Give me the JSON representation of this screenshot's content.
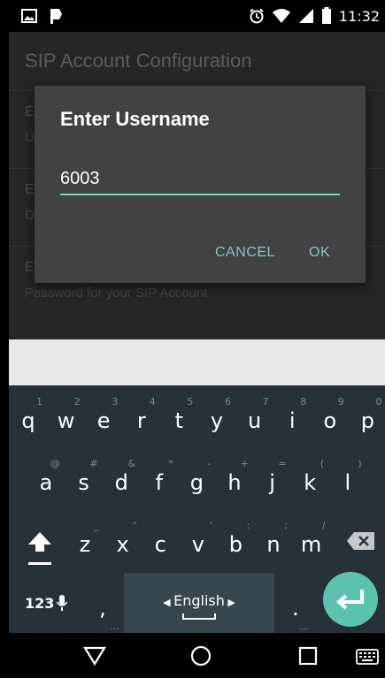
{
  "status_bar": {
    "time": "11:32"
  },
  "app": {
    "title": "SIP Account Configuration",
    "prefs": [
      {
        "title": "E",
        "summary": "U"
      },
      {
        "title": "E",
        "summary": "D"
      },
      {
        "title": "E",
        "summary": "Password for your SIP Account"
      }
    ]
  },
  "dialog": {
    "title": "Enter Username",
    "input_value": "6003",
    "cancel_label": "CANCEL",
    "ok_label": "OK"
  },
  "keyboard": {
    "row1": [
      {
        "k": "q",
        "h": "1"
      },
      {
        "k": "w",
        "h": "2"
      },
      {
        "k": "e",
        "h": "3"
      },
      {
        "k": "r",
        "h": "4"
      },
      {
        "k": "t",
        "h": "5"
      },
      {
        "k": "y",
        "h": "6"
      },
      {
        "k": "u",
        "h": "7"
      },
      {
        "k": "i",
        "h": "8"
      },
      {
        "k": "o",
        "h": "9"
      },
      {
        "k": "p",
        "h": "0"
      }
    ],
    "row2": [
      {
        "k": "a",
        "h": "@"
      },
      {
        "k": "s",
        "h": "#"
      },
      {
        "k": "d",
        "h": "&"
      },
      {
        "k": "f",
        "h": "*"
      },
      {
        "k": "g",
        "h": "-"
      },
      {
        "k": "h",
        "h": "+"
      },
      {
        "k": "j",
        "h": "="
      },
      {
        "k": "k",
        "h": "("
      },
      {
        "k": "l",
        "h": ")"
      }
    ],
    "row3": [
      {
        "k": "z",
        "h": "_"
      },
      {
        "k": "x",
        "h": "\""
      },
      {
        "k": "c",
        "h": ""
      },
      {
        "k": "v",
        "h": "'"
      },
      {
        "k": "b",
        "h": ":"
      },
      {
        "k": "n",
        "h": ";"
      },
      {
        "k": "m",
        "h": "/"
      }
    ],
    "symbols_label": "123",
    "comma": ",",
    "period": ".",
    "language": "English",
    "accent_color": "#5cc2b0"
  }
}
